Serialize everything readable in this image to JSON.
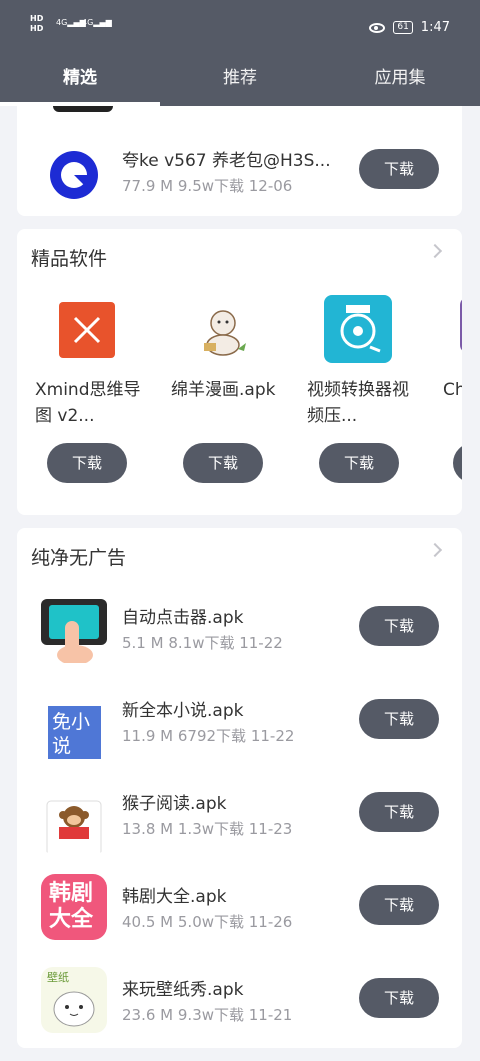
{
  "status": {
    "left_top": "HD",
    "left_bottom": "HD",
    "sig1": "4G",
    "sig2": "4G",
    "battery": "61",
    "time": "1:47"
  },
  "tabs": [
    {
      "label": "精选"
    },
    {
      "label": "推荐"
    },
    {
      "label": "应用集"
    }
  ],
  "top_item": {
    "name": "夸ke v567 养老包@H3S...",
    "meta": "77.9 M  9.5w下载  12-06",
    "download": "下载"
  },
  "featured": {
    "title": "精品软件",
    "items": [
      {
        "name": "Xmind思维导图 v2...",
        "download": "下载"
      },
      {
        "name": "绵羊漫画.apk",
        "download": "下载"
      },
      {
        "name": "视频转换器视频压...",
        "download": "下载"
      },
      {
        "name": "Ch方",
        "download": "下载"
      }
    ]
  },
  "adfree": {
    "title": "纯净无广告",
    "items": [
      {
        "name": "自动点击器.apk",
        "meta": "5.1 M  8.1w下载  11-22",
        "download": "下载"
      },
      {
        "name": "新全本小说.apk",
        "meta": "11.9 M  6792下载  11-22",
        "download": "下载",
        "icon_text": "免小说"
      },
      {
        "name": "猴子阅读.apk",
        "meta": "13.8 M  1.3w下载  11-23",
        "download": "下载"
      },
      {
        "name": "韩剧大全.apk",
        "meta": "40.5 M  5.0w下载  11-26",
        "download": "下载",
        "icon_text": "韩剧大全"
      },
      {
        "name": "来玩壁纸秀.apk",
        "meta": "23.6 M  9.3w下载  11-21",
        "download": "下载",
        "icon_text": "壁纸"
      }
    ]
  }
}
